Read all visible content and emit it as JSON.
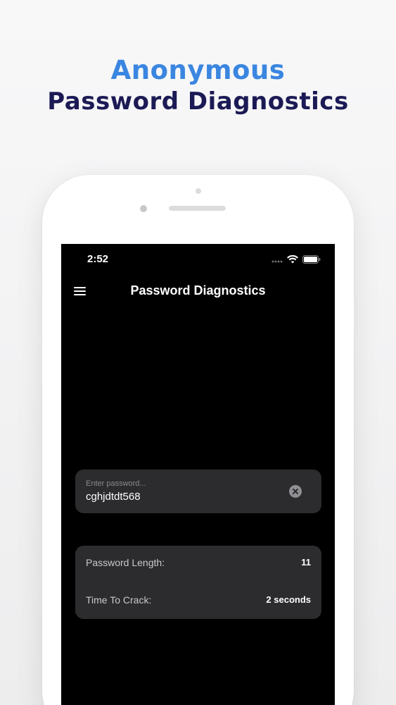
{
  "headline": {
    "line1": "Anonymous",
    "line2": "Password Diagnostics"
  },
  "status_bar": {
    "time": "2:52"
  },
  "nav": {
    "title": "Password Diagnostics"
  },
  "password_input": {
    "placeholder": "Enter password...",
    "value": "cghjdtdt568"
  },
  "stats": {
    "length_label": "Password Length:",
    "length_value": "11",
    "crack_label": "Time To Crack:",
    "crack_value": "2 seconds"
  },
  "colors": {
    "headline_accent": "#3a86e0",
    "headline_dark": "#1c1a55",
    "card_bg": "#2c2c2e",
    "screen_bg": "#000000"
  },
  "icons": [
    "hamburger-menu-icon",
    "signal-dots-icon",
    "wifi-icon",
    "battery-icon",
    "clear-icon"
  ]
}
